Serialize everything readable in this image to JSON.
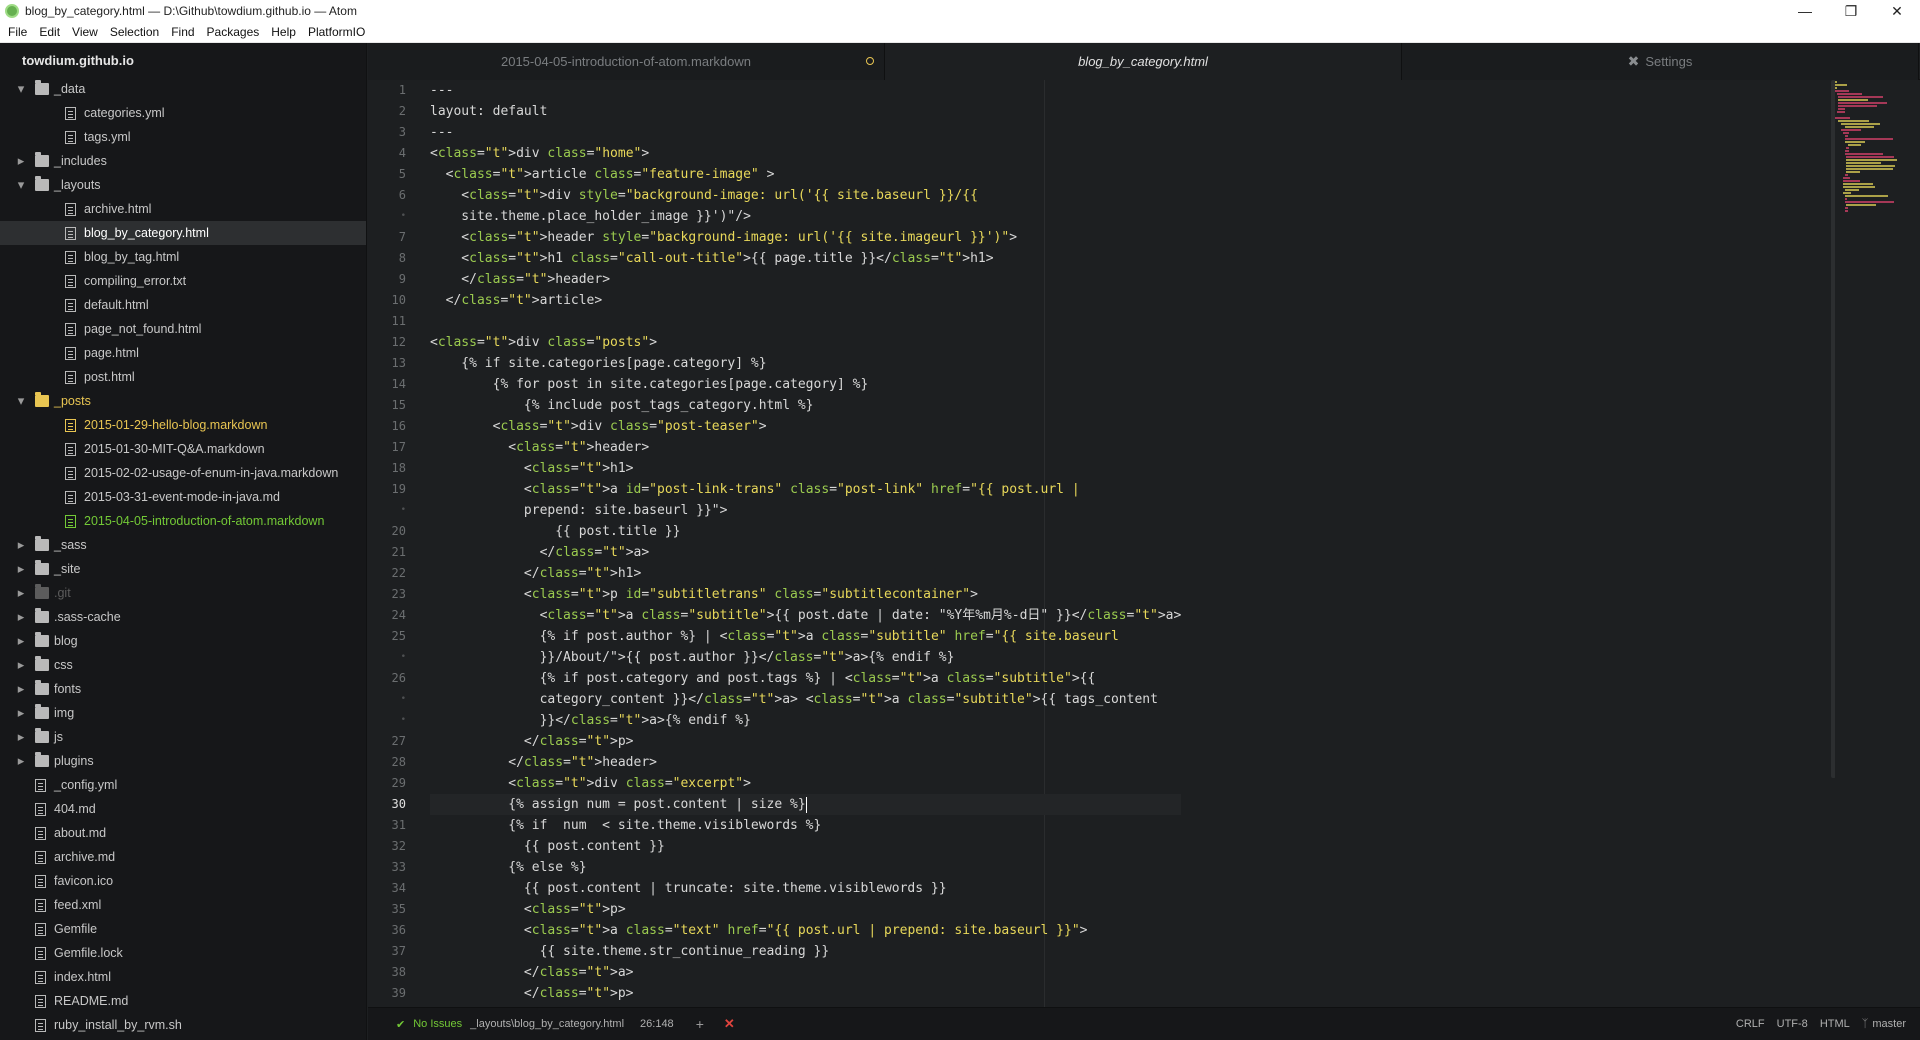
{
  "window": {
    "title": "blog_by_category.html — D:\\Github\\towdium.github.io — Atom"
  },
  "menu": [
    "File",
    "Edit",
    "View",
    "Selection",
    "Find",
    "Packages",
    "Help",
    "PlatformIO"
  ],
  "tree": {
    "root": "towdium.github.io",
    "items": [
      {
        "label": "_data",
        "type": "folder",
        "depth": 0,
        "expanded": true
      },
      {
        "label": "categories.yml",
        "type": "file",
        "depth": 1
      },
      {
        "label": "tags.yml",
        "type": "file",
        "depth": 1
      },
      {
        "label": "_includes",
        "type": "folder",
        "depth": 0,
        "expanded": false
      },
      {
        "label": "_layouts",
        "type": "folder",
        "depth": 0,
        "expanded": true
      },
      {
        "label": "archive.html",
        "type": "file",
        "depth": 1
      },
      {
        "label": "blog_by_category.html",
        "type": "file",
        "depth": 1,
        "selected": true
      },
      {
        "label": "blog_by_tag.html",
        "type": "file",
        "depth": 1
      },
      {
        "label": "compiling_error.txt",
        "type": "file",
        "depth": 1
      },
      {
        "label": "default.html",
        "type": "file",
        "depth": 1
      },
      {
        "label": "page_not_found.html",
        "type": "file",
        "depth": 1
      },
      {
        "label": "page.html",
        "type": "file",
        "depth": 1
      },
      {
        "label": "post.html",
        "type": "file",
        "depth": 1
      },
      {
        "label": "_posts",
        "type": "folder",
        "depth": 0,
        "expanded": true,
        "status": "modified"
      },
      {
        "label": "2015-01-29-hello-blog.markdown",
        "type": "file",
        "depth": 1,
        "status": "modified"
      },
      {
        "label": "2015-01-30-MIT-Q&A.markdown",
        "type": "file",
        "depth": 1
      },
      {
        "label": "2015-02-02-usage-of-enum-in-java.markdown",
        "type": "file",
        "depth": 1
      },
      {
        "label": "2015-03-31-event-mode-in-java.md",
        "type": "file",
        "depth": 1
      },
      {
        "label": "2015-04-05-introduction-of-atom.markdown",
        "type": "file",
        "depth": 1,
        "status": "added"
      },
      {
        "label": "_sass",
        "type": "folder",
        "depth": 0,
        "expanded": false
      },
      {
        "label": "_site",
        "type": "folder",
        "depth": 0,
        "expanded": false
      },
      {
        "label": ".git",
        "type": "folder",
        "depth": 0,
        "expanded": false,
        "status": "ignored"
      },
      {
        "label": ".sass-cache",
        "type": "folder",
        "depth": 0,
        "expanded": false
      },
      {
        "label": "blog",
        "type": "folder",
        "depth": 0,
        "expanded": false
      },
      {
        "label": "css",
        "type": "folder",
        "depth": 0,
        "expanded": false
      },
      {
        "label": "fonts",
        "type": "folder",
        "depth": 0,
        "expanded": false
      },
      {
        "label": "img",
        "type": "folder",
        "depth": 0,
        "expanded": false
      },
      {
        "label": "js",
        "type": "folder",
        "depth": 0,
        "expanded": false
      },
      {
        "label": "plugins",
        "type": "folder",
        "depth": 0,
        "expanded": false
      },
      {
        "label": "_config.yml",
        "type": "file",
        "depth": 0
      },
      {
        "label": "404.md",
        "type": "file",
        "depth": 0
      },
      {
        "label": "about.md",
        "type": "file",
        "depth": 0
      },
      {
        "label": "archive.md",
        "type": "file",
        "depth": 0
      },
      {
        "label": "favicon.ico",
        "type": "file",
        "depth": 0
      },
      {
        "label": "feed.xml",
        "type": "file",
        "depth": 0
      },
      {
        "label": "Gemfile",
        "type": "file",
        "depth": 0
      },
      {
        "label": "Gemfile.lock",
        "type": "file",
        "depth": 0
      },
      {
        "label": "index.html",
        "type": "file",
        "depth": 0
      },
      {
        "label": "README.md",
        "type": "file",
        "depth": 0
      },
      {
        "label": "ruby_install_by_rvm.sh",
        "type": "file",
        "depth": 0
      }
    ]
  },
  "tabs": [
    {
      "label": "2015-04-05-introduction-of-atom.markdown",
      "active": false,
      "modified": true
    },
    {
      "label": "blog_by_category.html",
      "active": true,
      "modified": false
    },
    {
      "label": "Settings",
      "active": false,
      "icon": "settings-tools-icon"
    }
  ],
  "editor": {
    "gutter": [
      "1",
      "2",
      "3",
      "4",
      "5",
      "6",
      "•",
      "7",
      "8",
      "9",
      "10",
      "11",
      "12",
      "13",
      "14",
      "15",
      "16",
      "17",
      "18",
      "19",
      "•",
      "20",
      "21",
      "22",
      "23",
      "24",
      "25",
      "•",
      "26",
      "•",
      "•",
      "27",
      "28",
      "29",
      "30",
      "31",
      "32",
      "33",
      "34",
      "35",
      "36",
      "37",
      "38",
      "39"
    ],
    "current_row": 34,
    "lines": [
      "---",
      "layout: default",
      "---",
      "<div class=\"home\">",
      "  <article class=\"feature-image\" >",
      "    <div style=\"background-image: url('{{ site.baseurl }}/{{",
      "    site.theme.place_holder_image }}')\"/>",
      "    <header style=\"background-image: url('{{ site.imageurl }}')\">",
      "    <h1 class=\"call-out-title\">{{ page.title }}</h1>",
      "    </header>",
      "  </article>",
      "",
      "<div class=\"posts\">",
      "    {% if site.categories[page.category] %}",
      "        {% for post in site.categories[page.category] %}",
      "            {% include post_tags_category.html %}",
      "        <div class=\"post-teaser\">",
      "          <header>",
      "            <h1>",
      "            <a id=\"post-link-trans\" class=\"post-link\" href=\"{{ post.url |",
      "            prepend: site.baseurl }}\">",
      "                {{ post.title }}",
      "              </a>",
      "            </h1>",
      "            <p id=\"subtitletrans\" class=\"subtitlecontainer\">",
      "              <a class=\"subtitle\">{{ post.date | date: \"%Y年%m月%-d日\" }}</a>",
      "              {% if post.author %} | <a class=\"subtitle\" href=\"{{ site.baseurl",
      "              }}/About/\">{{ post.author }}</a>{% endif %}",
      "              {% if post.category and post.tags %} | <a class=\"subtitle\">{{",
      "              category_content }}</a> <a class=\"subtitle\">{{ tags_content",
      "              }}</a>{% endif %}",
      "            </p>",
      "          </header>",
      "          <div class=\"excerpt\">",
      "          {% assign num = post.content | size %}",
      "          {% if  num  < site.theme.visiblewords %}",
      "            {{ post.content }}",
      "          {% else %}",
      "            {{ post.content | truncate: site.theme.visiblewords }}",
      "            <p>",
      "            <a class=\"text\" href=\"{{ post.url | prepend: site.baseurl }}\">",
      "              {{ site.theme.str_continue_reading }}",
      "            </a>",
      "            </p>"
    ]
  },
  "status": {
    "linter": "No Issues",
    "path": "_layouts\\blog_by_category.html",
    "cursor": "26:148",
    "line_ending": "CRLF",
    "encoding": "UTF-8",
    "grammar": "HTML",
    "branch": "master"
  },
  "colors": {
    "background": "#1d1f21",
    "tree_bg": "#161719",
    "tag": "#e0436f",
    "attribute": "#9bcb4f",
    "string": "#e8d85a",
    "modified": "#e8c552",
    "added": "#73c936"
  }
}
